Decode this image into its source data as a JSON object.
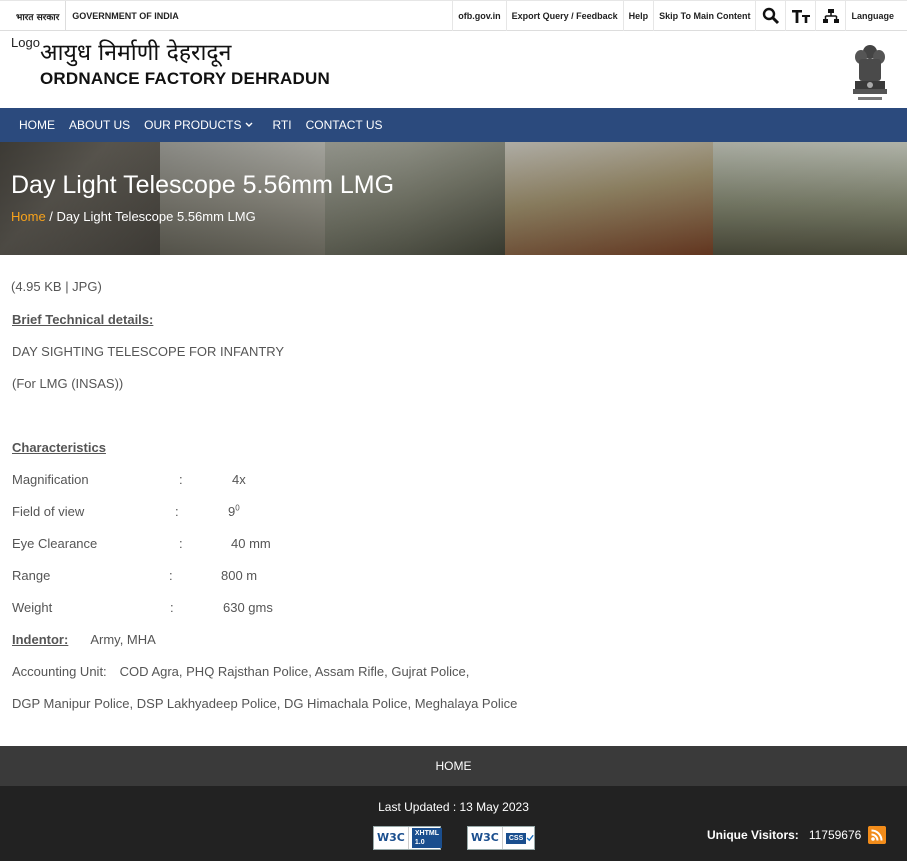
{
  "topbar": {
    "hindi_gov": "भारत सरकार",
    "gov": "GOVERNMENT OF INDIA",
    "links": [
      "ofb.gov.in",
      "Export Query / Feedback",
      "Help",
      "Skip To Main Content"
    ],
    "language": "Language"
  },
  "header": {
    "logo_alt": "Logo",
    "title_hindi": "आयुध निर्माणी देहरादून",
    "title_english": "ORDNANCE FACTORY DEHRADUN"
  },
  "nav": {
    "items": [
      "HOME",
      "ABOUT US",
      "OUR PRODUCTS",
      "RTI",
      "CONTACT US"
    ]
  },
  "banner": {
    "title": "Day Light Telescope 5.56mm LMG",
    "breadcrumb_home": "Home",
    "breadcrumb_sep": " / ",
    "breadcrumb_current": "Day Light Telescope 5.56mm LMG"
  },
  "content": {
    "file_info": "(4.95 KB | JPG)",
    "brief_heading": "Brief Technical details:",
    "desc1": "DAY  SIGHTING TELESCOPE FOR INFANTRY",
    "desc2": "(For  LMG (INSAS))",
    "char_heading": "Characteristics",
    "specs": [
      {
        "label": "Magnification",
        "value": "4x"
      },
      {
        "label": "Field of view",
        "value": "9",
        "sup": "0"
      },
      {
        "label": "Eye Clearance",
        "value": "40 mm"
      },
      {
        "label": "Range",
        "value": "800 m"
      },
      {
        "label": "Weight",
        "value": "630 gms"
      }
    ],
    "colon": ":",
    "indentor_label": "Indentor:",
    "indentor_value": "Army, MHA",
    "accounting_label": "Accounting Unit:",
    "accounting_line1": "COD Agra, PHQ Rajsthan Police, Assam Rifle, Gujrat Police,",
    "accounting_line2": "DGP Manipur Police, DSP Lakhyadeep Police,  DG Himachala Police, Meghalaya Police"
  },
  "footer": {
    "home": "HOME",
    "last_updated": "Last Updated : 13 May 2023",
    "badge1_w3c": "W3C",
    "badge1_text": "XHTML 1.0",
    "badge2_w3c": "W3C",
    "badge2_text": "CSS",
    "visitors_label": "Unique Visitors:",
    "visitors_count": "11759676"
  }
}
